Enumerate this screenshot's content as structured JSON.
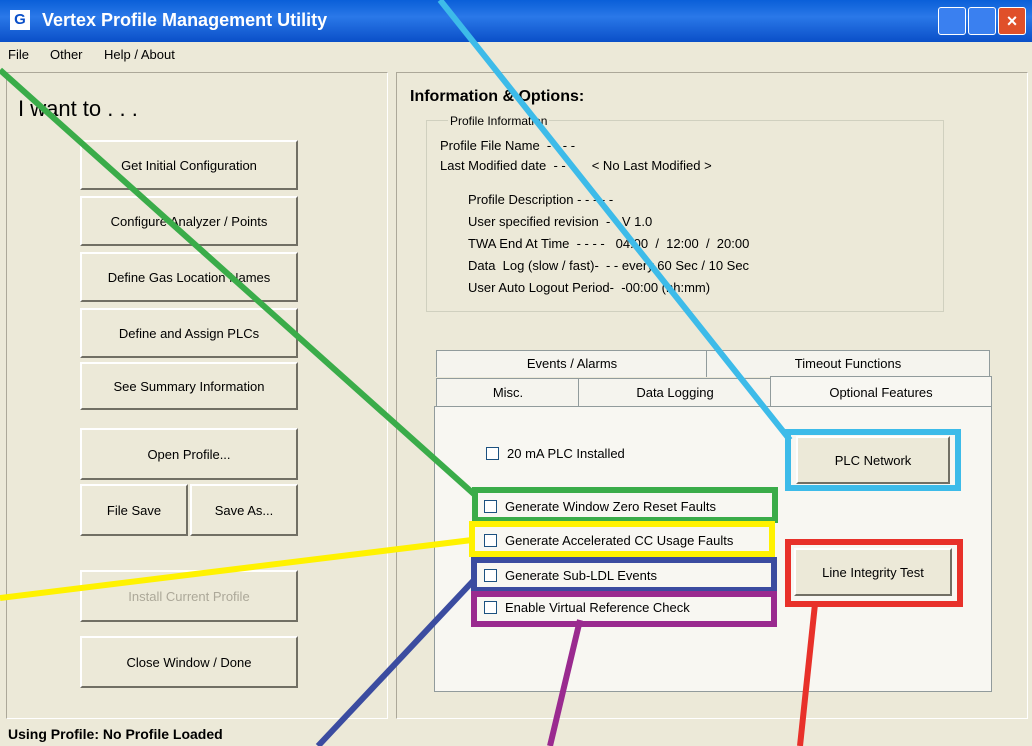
{
  "window": {
    "title": "Vertex Profile Management Utility",
    "icon": "app-logo-icon"
  },
  "menu": [
    "File",
    "Other",
    "Help / About"
  ],
  "left": {
    "heading": "I want to . . .",
    "buttons": {
      "initial_config": "Get Initial Configuration",
      "configure": "Configure Analyzer / Points",
      "gas_names": "Define Gas Location Names",
      "plcs": "Define and Assign PLCs",
      "summary": "See Summary Information",
      "open": "Open Profile...",
      "file_save": "File Save",
      "save_as": "Save As...",
      "install": "Install Current Profile",
      "close": "Close Window / Done"
    }
  },
  "info": {
    "heading": "Information & Options:",
    "group_label": "Profile Information",
    "lines": {
      "file_name": "Profile File Name  - - - -",
      "last_modified": "Last Modified date  - - -     < No Last Modified >",
      "description": "Profile Description - - - - -",
      "revision": "User specified revision  - - V 1.0",
      "twa": "TWA End At Time  - - - -   04:00  /  12:00  /  20:00",
      "data_log": "Data  Log (slow / fast)-  - - every 60 Sec / 10 Sec",
      "logout": "User Auto Logout Period-  -00:00 (hh:mm)"
    }
  },
  "tabs": {
    "events": "Events / Alarms",
    "timeout": "Timeout Functions",
    "misc": "Misc.",
    "data_logging": "Data Logging",
    "optional": "Optional Features"
  },
  "options": {
    "plc_20ma": "20 mA PLC Installed",
    "zero_reset": "Generate Window Zero Reset Faults",
    "cc_usage": "Generate Accelerated CC Usage Faults",
    "sub_ldl": "Generate Sub-LDL Events",
    "virtual_ref": "Enable Virtual Reference Check",
    "plc_network": "PLC Network",
    "line_integrity": "Line Integrity Test"
  },
  "status": {
    "text": "Using Profile:  No Profile Loaded"
  },
  "annotation_colors": {
    "green": "#3aac49",
    "cyan": "#3dbbe9",
    "yellow": "#fff200",
    "blue": "#3b4ca0",
    "purple": "#9a2a8f",
    "red": "#e8312a"
  }
}
